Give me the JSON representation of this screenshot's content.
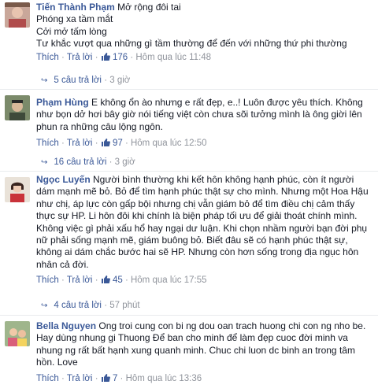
{
  "comments": [
    {
      "author": "Tiến Thành Phạm",
      "text": "Mở rộng đôi tai\nPhóng xa tầm mắt\nCởi mở tấm lòng\nTư khắc vượt qua những gì tầm thường để đến với những thứ phi thường",
      "like": "Thích",
      "reply": "Trả lời",
      "likes": "176",
      "time": "Hôm qua lúc 11:48",
      "replies": "5 câu trả lời",
      "replies_ago": "3 giờ"
    },
    {
      "author": "Phạm Hùng",
      "text": "E không ổn ào nhưng e rất đẹp, e..! Luôn được yêu thích. Không như bọn dở hơi bây giờ nói tiếng việt còn chưa sõi tưởng mình là ông giời lên phun ra những câu lộng ngôn.",
      "like": "Thích",
      "reply": "Trả lời",
      "likes": "97",
      "time": "Hôm qua lúc 12:50",
      "replies": "16 câu trả lời",
      "replies_ago": "3 giờ"
    },
    {
      "author": "Ngọc Luyến",
      "text": "Người bình thường khi kết hôn không hạnh phúc, còn ít người dám mạnh mẽ bỏ. Bỏ để tìm hạnh phúc thật sự cho mình. Nhưng một Hoa Hậu như chị, áp lực còn gấp bội nhưng chị vẫn giám bỏ để tìm điều chị cảm thấy thực sự HP. Li hôn đôi khi chính là biện pháp tối ưu để giải thoát chính mình. Không việc gì phải xấu hổ hay ngại dư luận. Khi chọn nhầm người bạn đời phụ nữ phải sống mạnh mẽ, giám buông bỏ. Biết đâu sẽ có hạnh phúc thật sự, không ai dám chắc bước hai sẽ HP. Nhưng còn hơn sống trong địa ngục hôn nhân cả đời.",
      "like": "Thích",
      "reply": "Trả lời",
      "likes": "45",
      "time": "Hôm qua lúc 17:55",
      "replies": "4 câu trả lời",
      "replies_ago": "57 phút"
    },
    {
      "author": "Bella Nguyen",
      "text": "Ong troi cung con bi ng dou oan trach huong chi con ng nho be. Hay dùng nhung gi Thuong Để ban cho minh để làm đẹp cuoc đời minh va nhung ng rất bất hạnh xung quanh minh. Chuc chi luon dc binh an trong tâm hồn. Love",
      "like": "Thích",
      "reply": "Trả lời",
      "likes": "7",
      "time": "Hôm qua lúc 13:36",
      "replies": "",
      "replies_ago": ""
    }
  ],
  "separator": "·",
  "colors": {
    "link": "#3b5998",
    "meta": "#90949c",
    "text": "#141823"
  }
}
